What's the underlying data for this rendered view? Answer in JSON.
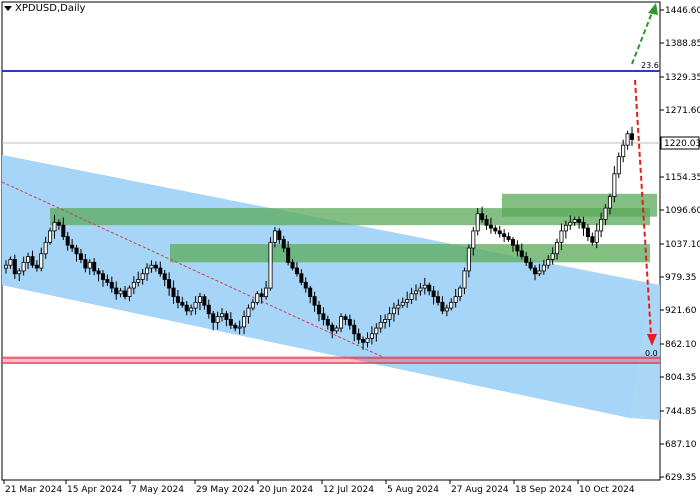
{
  "chart": {
    "symbol_title": "XPDUSD,Daily",
    "current_price": "1220.03",
    "fib_top_label": "23.6",
    "fib_bottom_label": "0.0",
    "price_axis": [
      "1446.60",
      "1388.85",
      "1329.35",
      "1271.60",
      "1212.10",
      "1154.35",
      "1096.60",
      "1037.10",
      "979.35",
      "921.60",
      "862.10",
      "804.35",
      "744.85",
      "687.10",
      "629.35"
    ],
    "time_axis": [
      "21 Mar 2024",
      "15 Apr 2024",
      "7 May 2024",
      "29 May 2024",
      "20 Jun 2024",
      "12 Jul 2024",
      "5 Aug 2024",
      "27 Aug 2024",
      "18 Sep 2024",
      "10 Oct 2024"
    ],
    "colors": {
      "channel": "#a6d5f7",
      "zone": "#5aaa5a",
      "resistance": "#1f3fd1",
      "support": "#e8364a",
      "arrow_up": "#2a9a2a",
      "arrow_down": "#e02020"
    }
  },
  "chart_data": {
    "type": "candlestick",
    "symbol": "XPDUSD",
    "timeframe": "Daily",
    "ylim": [
      629.35,
      1480
    ],
    "levels": {
      "resistance": 1329.35,
      "support": 830
    },
    "zones": [
      {
        "from": 1070,
        "to": 1100
      },
      {
        "from": 1010,
        "to": 1037
      },
      {
        "from": 1085,
        "to": 1120
      }
    ],
    "close": [
      1000,
      1010,
      985,
      990,
      1005,
      1015,
      1000,
      995,
      1020,
      1040,
      1060,
      1075,
      1070,
      1050,
      1035,
      1030,
      1020,
      1010,
      995,
      1005,
      990,
      985,
      975,
      970,
      960,
      950,
      955,
      945,
      960,
      970,
      975,
      985,
      995,
      1000,
      995,
      985,
      975,
      960,
      945,
      935,
      930,
      920,
      925,
      935,
      945,
      930,
      915,
      900,
      910,
      915,
      905,
      895,
      890,
      892,
      910,
      925,
      935,
      950,
      945,
      960,
      1040,
      1060,
      1045,
      1030,
      1005,
      995,
      985,
      970,
      960,
      945,
      930,
      915,
      905,
      895,
      885,
      890,
      910,
      905,
      895,
      880,
      870,
      865,
      872,
      880,
      890,
      900,
      905,
      915,
      925,
      930,
      935,
      940,
      950,
      955,
      960,
      965,
      955,
      945,
      935,
      920,
      925,
      935,
      945,
      960,
      990,
      1030,
      1060,
      1090,
      1080,
      1070,
      1065,
      1060,
      1055,
      1050,
      1045,
      1035,
      1025,
      1015,
      1005,
      995,
      985,
      990,
      1000,
      1010,
      1020,
      1040,
      1060,
      1070,
      1075,
      1080,
      1075,
      1065,
      1050,
      1040,
      1060,
      1080,
      1100,
      1120,
      1160,
      1190,
      1210,
      1230,
      1220
    ]
  }
}
